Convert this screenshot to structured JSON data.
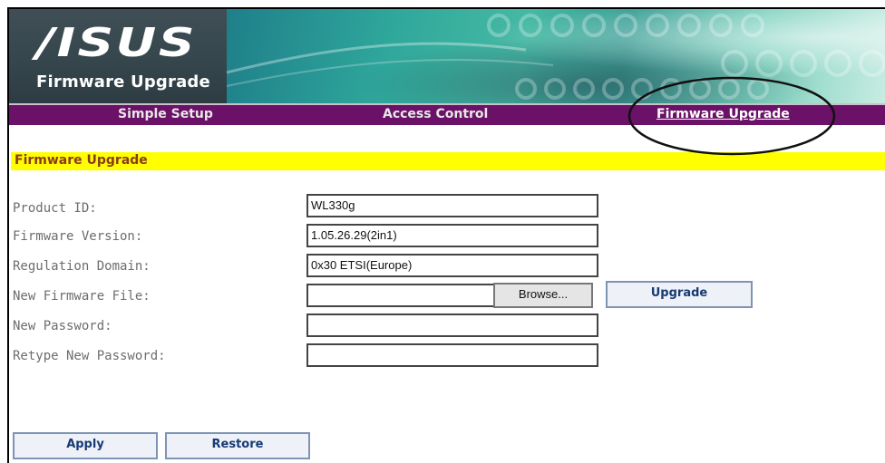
{
  "header": {
    "logo_text": "/ISUS",
    "subtitle": "Firmware Upgrade"
  },
  "nav": {
    "items": [
      {
        "label": "Simple Setup",
        "active": false
      },
      {
        "label": "Access Control",
        "active": false
      },
      {
        "label": "Firmware Upgrade",
        "active": true
      }
    ]
  },
  "section": {
    "title": "Firmware Upgrade"
  },
  "form": {
    "product_id_label": "Product ID:",
    "product_id_value": "WL330g",
    "firmware_version_label": "Firmware Version:",
    "firmware_version_value": "1.05.26.29(2in1)",
    "regulation_domain_label": "Regulation Domain:",
    "regulation_domain_value": "0x30 ETSI(Europe)",
    "new_firmware_file_label": "New Firmware File:",
    "new_firmware_file_value": "",
    "browse_label": "Browse...",
    "upgrade_label": "Upgrade",
    "new_password_label": "New Password:",
    "new_password_value": "",
    "retype_password_label": "Retype New Password:",
    "retype_password_value": ""
  },
  "actions": {
    "apply_label": "Apply",
    "restore_label": "Restore"
  },
  "colors": {
    "nav_bg": "#6b1167",
    "section_bar": "#ffff00",
    "section_title": "#8a3a1a",
    "button_text": "#173a73"
  }
}
